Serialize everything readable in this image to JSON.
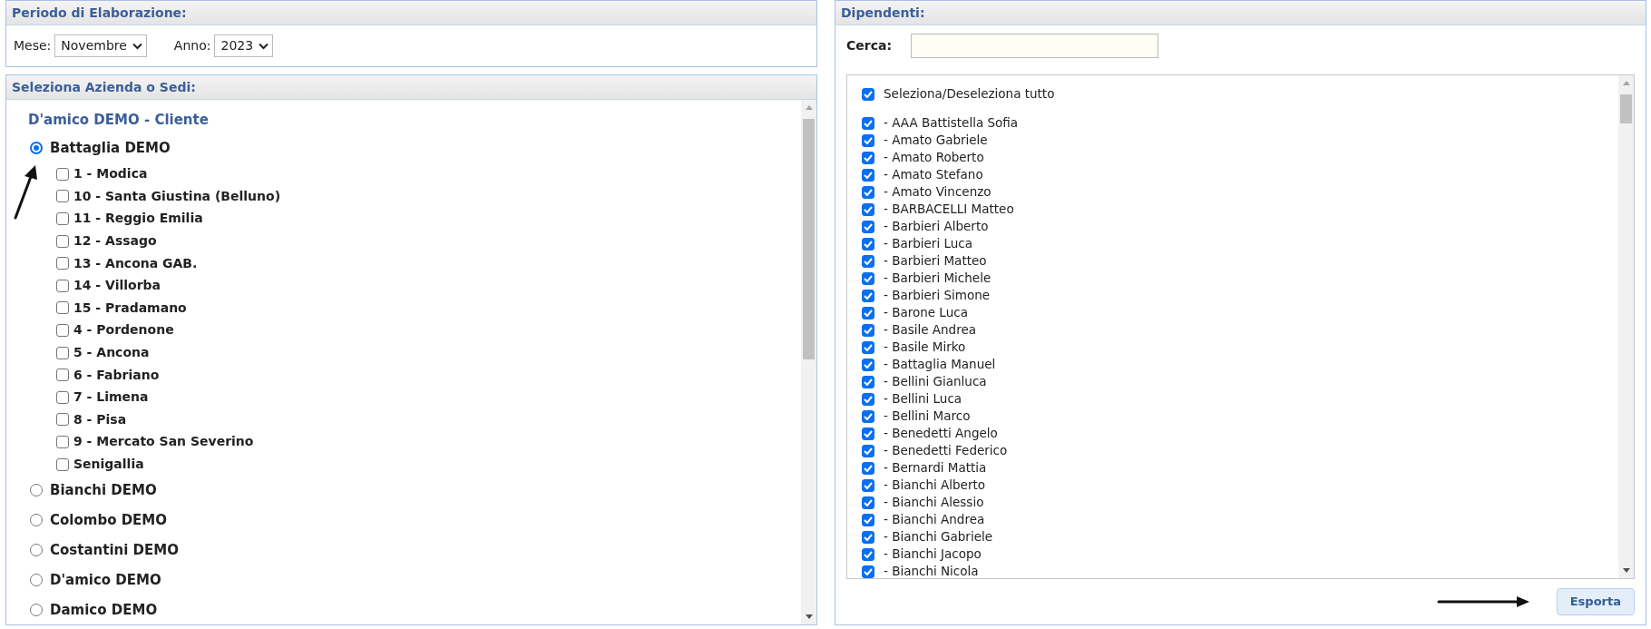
{
  "period": {
    "title": "Periodo di Elaborazione:",
    "month_label": "Mese:",
    "month": "Novembre",
    "year_label": "Anno:",
    "year": "2023"
  },
  "companies": {
    "title": "Seleziona Azienda o Sedi:",
    "client": "D'amico DEMO - Cliente",
    "items": [
      {
        "label": "Battaglia DEMO",
        "selected": true,
        "sites": [
          {
            "label": "1 - Modica",
            "checked": false
          },
          {
            "label": "10 - Santa Giustina (Belluno)",
            "checked": false
          },
          {
            "label": "11 - Reggio Emilia",
            "checked": false
          },
          {
            "label": "12 - Assago",
            "checked": false
          },
          {
            "label": "13 - Ancona GAB.",
            "checked": false
          },
          {
            "label": "14 - Villorba",
            "checked": false
          },
          {
            "label": "15 - Pradamano",
            "checked": false
          },
          {
            "label": "4 - Pordenone",
            "checked": false
          },
          {
            "label": "5 - Ancona",
            "checked": false
          },
          {
            "label": "6 - Fabriano",
            "checked": false
          },
          {
            "label": "7 - Limena",
            "checked": false
          },
          {
            "label": "8 - Pisa",
            "checked": false
          },
          {
            "label": "9 - Mercato San Severino",
            "checked": false
          },
          {
            "label": "Senigallia",
            "checked": false
          }
        ]
      },
      {
        "label": "Bianchi DEMO",
        "selected": false
      },
      {
        "label": "Colombo DEMO",
        "selected": false
      },
      {
        "label": "Costantini DEMO",
        "selected": false
      },
      {
        "label": "D'amico DEMO",
        "selected": false
      },
      {
        "label": "Damico DEMO",
        "selected": false
      }
    ]
  },
  "employees": {
    "title": "Dipendenti:",
    "search_label": "Cerca:",
    "select_all": {
      "label": "Seleziona/Deseleziona tutto",
      "checked": true
    },
    "items": [
      {
        "label": "- AAA Battistella Sofia",
        "checked": true
      },
      {
        "label": "- Amato Gabriele",
        "checked": true
      },
      {
        "label": "- Amato Roberto",
        "checked": true
      },
      {
        "label": "- Amato Stefano",
        "checked": true
      },
      {
        "label": "- Amato Vincenzo",
        "checked": true
      },
      {
        "label": "- BARBACELLI Matteo",
        "checked": true
      },
      {
        "label": "- Barbieri Alberto",
        "checked": true
      },
      {
        "label": "- Barbieri Luca",
        "checked": true
      },
      {
        "label": "- Barbieri Matteo",
        "checked": true
      },
      {
        "label": "- Barbieri Michele",
        "checked": true
      },
      {
        "label": "- Barbieri Simone",
        "checked": true
      },
      {
        "label": "- Barone Luca",
        "checked": true
      },
      {
        "label": "- Basile Andrea",
        "checked": true
      },
      {
        "label": "- Basile Mirko",
        "checked": true
      },
      {
        "label": "- Battaglia Manuel",
        "checked": true
      },
      {
        "label": "- Bellini Gianluca",
        "checked": true
      },
      {
        "label": "- Bellini Luca",
        "checked": true
      },
      {
        "label": "- Bellini Marco",
        "checked": true
      },
      {
        "label": "- Benedetti Angelo",
        "checked": true
      },
      {
        "label": "- Benedetti Federico",
        "checked": true
      },
      {
        "label": "- Bernardi Mattia",
        "checked": true
      },
      {
        "label": "- Bianchi Alberto",
        "checked": true
      },
      {
        "label": "- Bianchi Alessio",
        "checked": true
      },
      {
        "label": "- Bianchi Andrea",
        "checked": true
      },
      {
        "label": "- Bianchi Gabriele",
        "checked": true
      },
      {
        "label": "- Bianchi Jacopo",
        "checked": true
      },
      {
        "label": "- Bianchi Nicola",
        "checked": true
      }
    ]
  },
  "export_button": "Esporta"
}
